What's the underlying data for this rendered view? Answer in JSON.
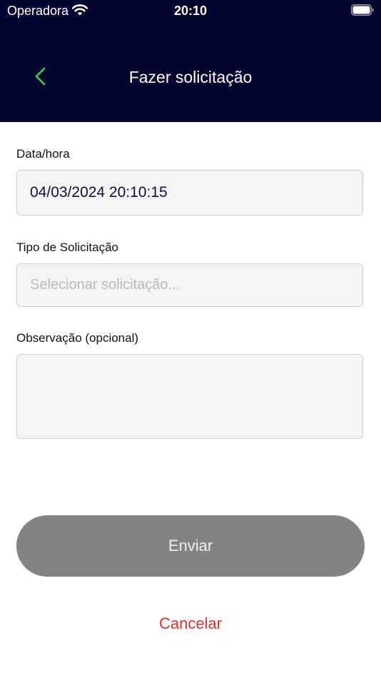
{
  "status_bar": {
    "carrier": "Operadora",
    "time": "20:10",
    "icons": [
      "wifi-icon",
      "battery-icon"
    ]
  },
  "nav": {
    "title": "Fazer solicitação",
    "back_icon": "chevron-left-icon",
    "back_color": "#2ecc40"
  },
  "form": {
    "datetime": {
      "label": "Data/hora",
      "value": "04/03/2024 20:10:15"
    },
    "request_type": {
      "label": "Tipo de Solicitação",
      "placeholder": "Selecionar solicitação..."
    },
    "observation": {
      "label": "Observação (opcional)",
      "value": ""
    }
  },
  "actions": {
    "send_label": "Enviar",
    "cancel_label": "Cancelar"
  },
  "colors": {
    "header_bg": "#02032e",
    "cancel": "#e0322e",
    "send_disabled_bg": "#838383"
  }
}
